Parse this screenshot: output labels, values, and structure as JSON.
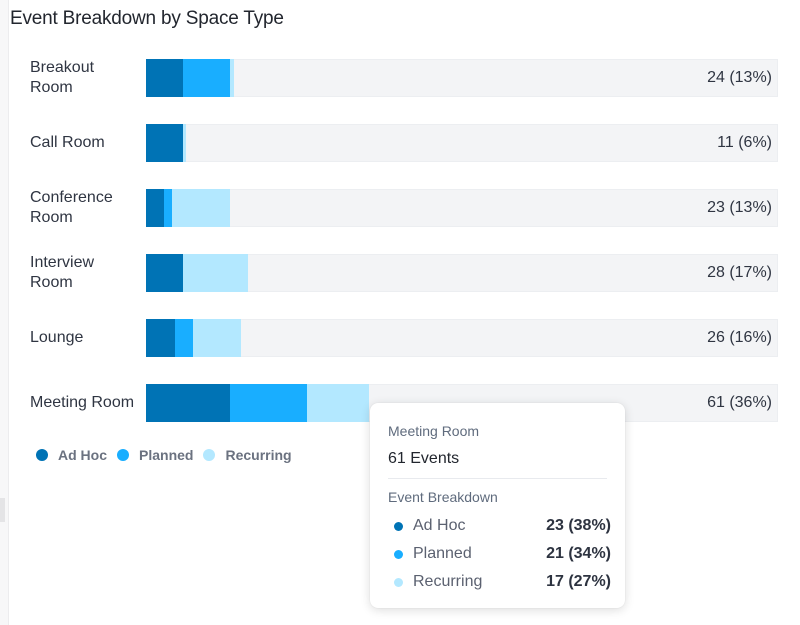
{
  "title": "Event Breakdown by Space Type",
  "colors": {
    "ad_hoc": "#0073b5",
    "planned": "#19aeff",
    "recurring": "#b3e8ff",
    "track": "#f3f4f6"
  },
  "legend": [
    {
      "label": "Ad Hoc",
      "color": "#0073b5"
    },
    {
      "label": "Planned",
      "color": "#19aeff"
    },
    {
      "label": "Recurring",
      "color": "#b3e8ff"
    }
  ],
  "chart_data": {
    "type": "bar",
    "orientation": "horizontal",
    "stacked": true,
    "title": "Event Breakdown by Space Type",
    "categories": [
      "Breakout Room",
      "Call Room",
      "Conference Room",
      "Interview Room",
      "Lounge",
      "Meeting Room"
    ],
    "series": [
      {
        "name": "Ad Hoc",
        "color": "#0073b5",
        "values": [
          10,
          10,
          5,
          10,
          8,
          23
        ]
      },
      {
        "name": "Planned",
        "color": "#19aeff",
        "values": [
          13,
          0,
          2,
          0,
          5,
          21
        ]
      },
      {
        "name": "Recurring",
        "color": "#b3e8ff",
        "values": [
          1,
          1,
          16,
          18,
          13,
          17
        ]
      }
    ],
    "totals": [
      24,
      11,
      23,
      28,
      26,
      61
    ],
    "value_labels": [
      "24 (13%)",
      "11 (6%)",
      "23 (13%)",
      "28 (17%)",
      "26 (16%)",
      "61 (36%)"
    ],
    "xlim": [
      0,
      173
    ],
    "grid": false,
    "legend_position": "bottom-left",
    "xlabel": "",
    "ylabel": ""
  },
  "rows": [
    {
      "label": "Breakout Room",
      "value_label": "24 (13%)"
    },
    {
      "label": "Call Room",
      "value_label": "11 (6%)"
    },
    {
      "label": "Conference Room",
      "value_label": "23 (13%)"
    },
    {
      "label": "Interview Room",
      "value_label": "28 (17%)"
    },
    {
      "label": "Lounge",
      "value_label": "26 (16%)"
    },
    {
      "label": "Meeting Room",
      "value_label": "61 (36%)"
    }
  ],
  "tooltip": {
    "title": "Meeting Room",
    "total": "61 Events",
    "section": "Event Breakdown",
    "items": [
      {
        "label": "Ad Hoc",
        "value": "23 (38%)",
        "color": "#0073b5"
      },
      {
        "label": "Planned",
        "value": "21 (34%)",
        "color": "#19aeff"
      },
      {
        "label": "Recurring",
        "value": "17 (27%)",
        "color": "#b3e8ff"
      }
    ]
  }
}
